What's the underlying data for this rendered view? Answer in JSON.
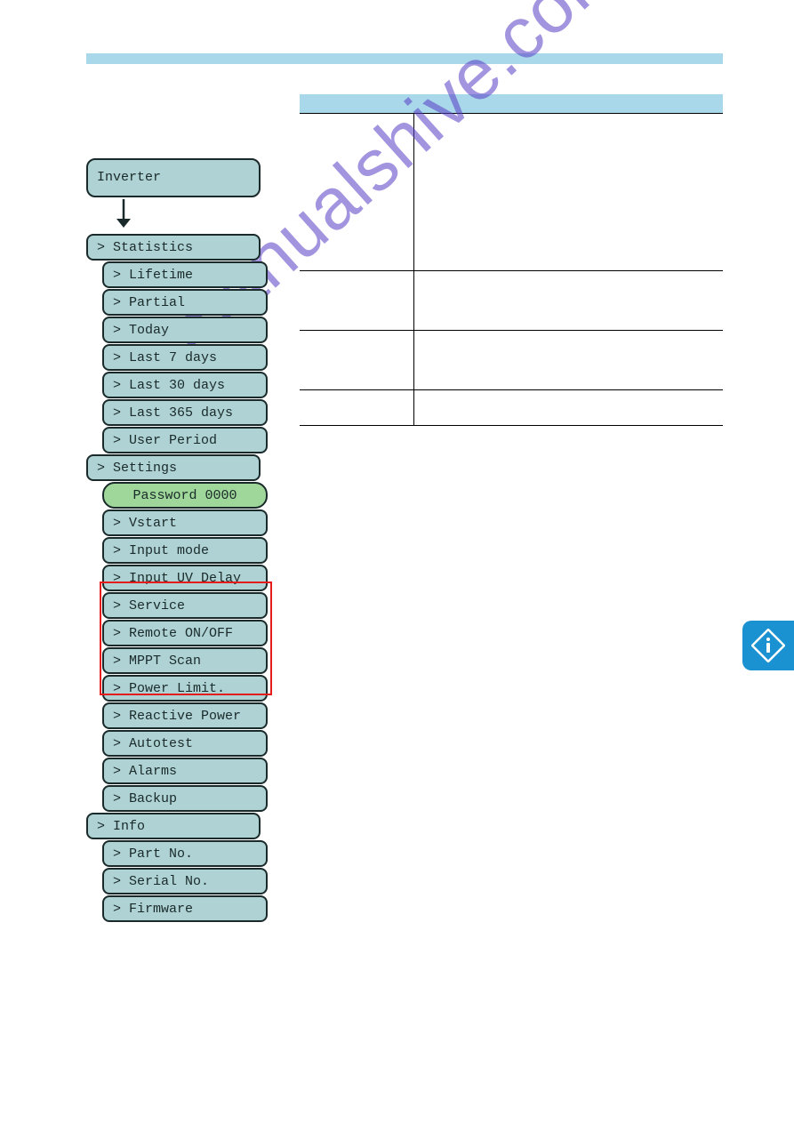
{
  "watermark": "manualshive.com",
  "menu": {
    "root": "Inverter",
    "sections": [
      {
        "label": "> Statistics",
        "items": [
          "> Lifetime",
          "> Partial",
          "> Today",
          "> Last 7 days",
          "> Last 30 days",
          "> Last 365 days",
          "> User Period"
        ]
      },
      {
        "label": "> Settings",
        "password": "Password 0000",
        "items": [
          "> Vstart",
          "> Input mode",
          "> Input UV Delay",
          "> Service",
          "> Remote ON/OFF",
          "> MPPT Scan",
          "> Power Limit.",
          "> Reactive Power",
          "> Autotest",
          "> Alarms",
          "> Backup"
        ]
      },
      {
        "label": "> Info",
        "items": [
          "> Part No.",
          "> Serial No.",
          "> Firmware"
        ]
      }
    ]
  }
}
